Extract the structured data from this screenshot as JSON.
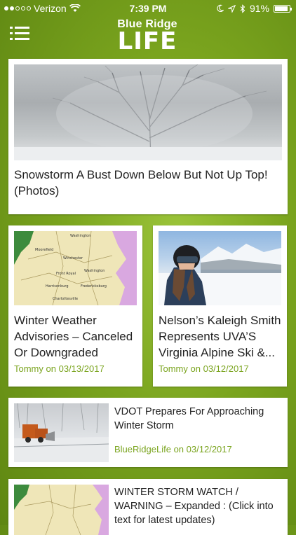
{
  "status_bar": {
    "carrier": "Verizon",
    "time": "7:39 PM",
    "battery": "91%",
    "battery_level": 0.91,
    "signal_bars": 2
  },
  "header": {
    "logo_line1": "Blue Ridge",
    "logo_line2": "LIFE",
    "menu_icon": "hamburger-menu-icon"
  },
  "articles": [
    {
      "title": "Snowstorm A Bust Down Below But Not Up Top! (Photos)"
    },
    {
      "title": "Winter Weather Advisories – Canceled Or Downgraded",
      "author": "Tommy",
      "date": "03/13/2017"
    },
    {
      "title": "Nelson’s Kaleigh Smith Represents UVA’S Virginia Alpine Ski &...",
      "author": "Tommy",
      "date": "03/12/2017"
    },
    {
      "title": "VDOT Prepares For Approaching Winter Storm",
      "author": "BlueRidgeLife",
      "date": "03/12/2017"
    },
    {
      "title": "WINTER STORM WATCH / WARNING – Expanded : (Click into text for latest updates)"
    }
  ],
  "colors": {
    "accent_green": "#7aa41e",
    "background": "#7aa41e"
  }
}
